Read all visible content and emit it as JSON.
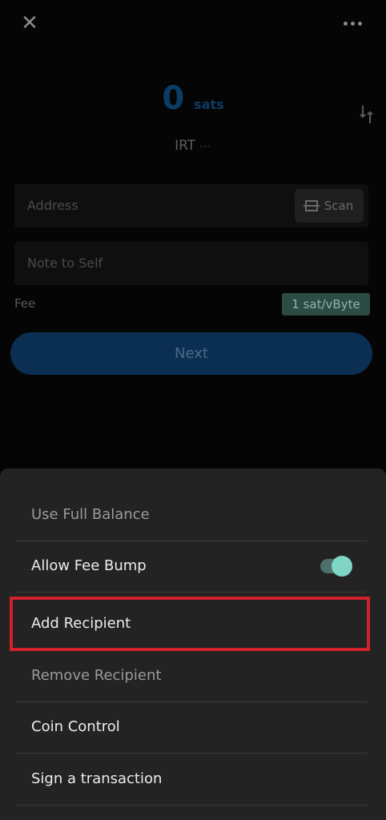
{
  "top_bar": {
    "close_glyph": "✕"
  },
  "amount": {
    "value": "0",
    "unit": "sats",
    "currency": "IRT",
    "currency_suffix": "···"
  },
  "address": {
    "placeholder": "Address",
    "scan_label": "Scan"
  },
  "note": {
    "placeholder": "Note to Self"
  },
  "fee": {
    "label": "Fee",
    "value": "1 sat/vByte"
  },
  "next_button": {
    "label": "Next"
  },
  "sheet": {
    "items": [
      {
        "label": "Use Full Balance"
      },
      {
        "label": "Allow Fee Bump",
        "toggle_on": true
      },
      {
        "label": "Add Recipient"
      },
      {
        "label": "Remove Recipient"
      },
      {
        "label": "Coin Control"
      },
      {
        "label": "Sign a transaction"
      }
    ]
  },
  "colors": {
    "accent_blue": "#0b2f53",
    "fee_badge": "#2c4b45",
    "toggle_knob": "#7fd6c4",
    "highlight_red": "#d2202c"
  }
}
